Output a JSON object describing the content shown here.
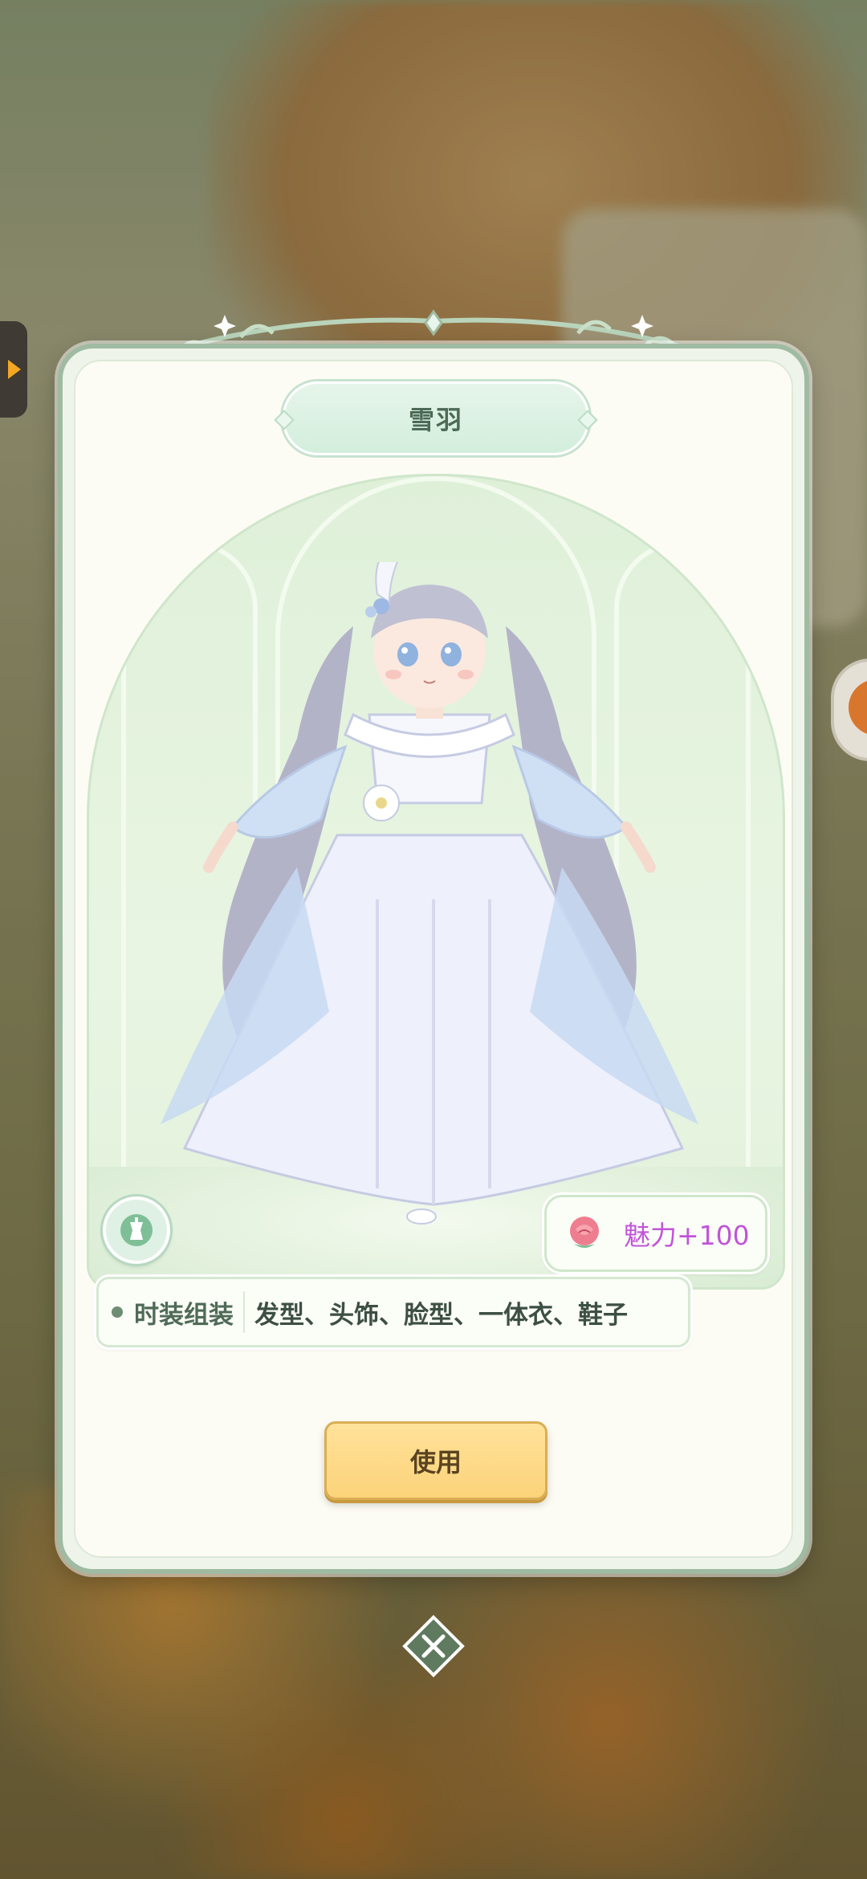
{
  "outfit": {
    "name": "雪羽",
    "charm_label": "魅力+100",
    "category_label": "时装组装",
    "parts": "发型、头饰、脸型、一体衣、鞋子"
  },
  "actions": {
    "use_label": "使用"
  },
  "icons": {
    "edge_arrow": "arrow-right-icon",
    "style": "mannequin-icon",
    "charm": "rose-icon",
    "close": "close-icon"
  },
  "colors": {
    "card_border": "#9fbba2",
    "card_background": "#fdfcf4",
    "charm_text": "#c055d8",
    "use_button": "#fcd37a",
    "close_button": "#5f7a5e"
  }
}
